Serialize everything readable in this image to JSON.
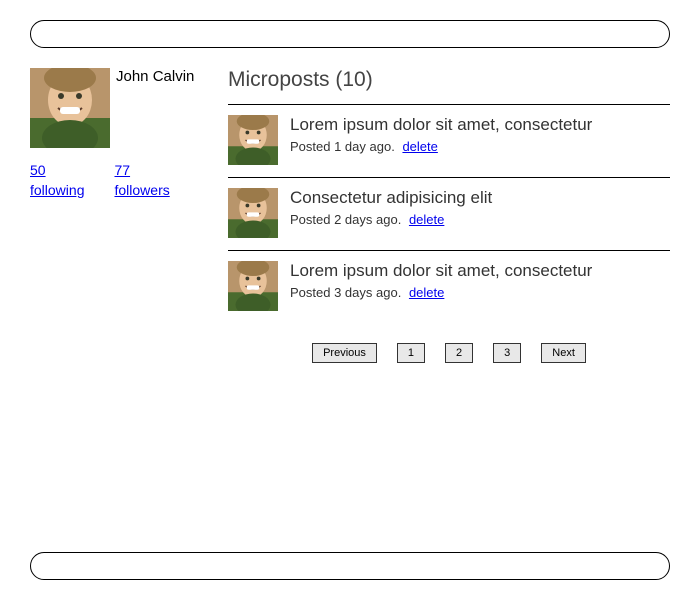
{
  "profile": {
    "name": "John Calvin"
  },
  "stats": {
    "following_count": "50",
    "following_label": "following",
    "followers_count": "77",
    "followers_label": "followers"
  },
  "microposts": {
    "title": "Microposts (10)",
    "posts": [
      {
        "text": "Lorem ipsum dolor sit amet, consectetur",
        "meta": "Posted 1 day ago.",
        "delete": "delete"
      },
      {
        "text": "Consectetur adipisicing elit",
        "meta": "Posted 2 days ago.",
        "delete": "delete"
      },
      {
        "text": "Lorem ipsum dolor sit amet, consectetur",
        "meta": "Posted 3 days ago.",
        "delete": "delete"
      }
    ]
  },
  "pagination": {
    "previous": "Previous",
    "pages": [
      "1",
      "2",
      "3"
    ],
    "next": "Next"
  }
}
